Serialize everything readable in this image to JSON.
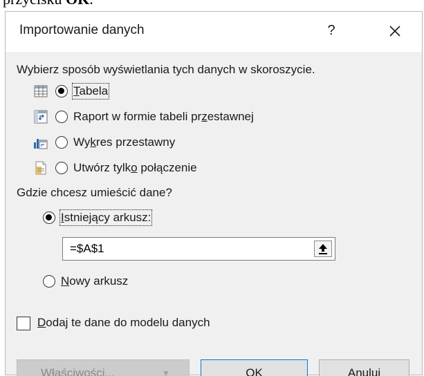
{
  "top_caption": {
    "prefix": "przycisku ",
    "bold": "OK",
    "suffix": "."
  },
  "dialog": {
    "title": "Importowanie danych",
    "help_label": "?",
    "close_icon": "close-icon"
  },
  "view_section": {
    "heading": "Wybierz sposób wyświetlania tych danych w skoroszycie.",
    "options": [
      {
        "icon": "table-icon",
        "pre": "",
        "u": "T",
        "post": "abela",
        "checked": true
      },
      {
        "icon": "pivot-table-icon",
        "pre": "Raport w formie tabeli pr",
        "u": "z",
        "post": "estawnej",
        "checked": false
      },
      {
        "icon": "pivot-chart-icon",
        "pre": "Wy",
        "u": "k",
        "post": "res przestawny",
        "checked": false
      },
      {
        "icon": "connection-only-icon",
        "pre": "Utwórz tylk",
        "u": "o",
        "post": " połączenie",
        "checked": false
      }
    ]
  },
  "location_section": {
    "heading": "Gdzie chcesz umieścić dane?",
    "existing_sheet": {
      "pre": "",
      "u": "I",
      "post": "stniejący arkusz:",
      "checked": true
    },
    "cell_reference": "=$A$1",
    "new_sheet": {
      "pre": "",
      "u": "N",
      "post": "owy arkusz",
      "checked": false
    }
  },
  "data_model": {
    "pre": "",
    "u": "D",
    "post": "odaj te dane do modelu danych",
    "checked": false
  },
  "buttons": {
    "properties": {
      "pre": "Właś",
      "u": "c",
      "post": "iwości...",
      "arrow": "▼",
      "enabled": false
    },
    "ok": "OK",
    "cancel": "Anuluj"
  },
  "colors": {
    "dialog_body_bg": "#f0f0f0",
    "title_bg": "#ffffff",
    "ok_border": "#0078d7",
    "disabled_button_bg": "#cccccc"
  }
}
